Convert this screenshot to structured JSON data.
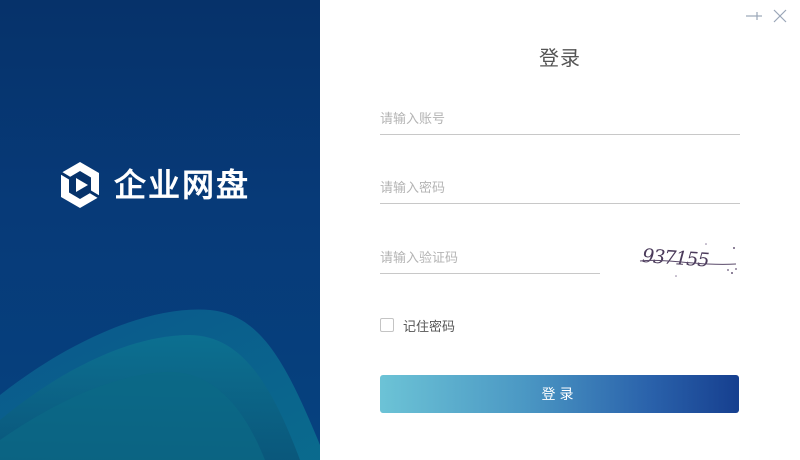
{
  "brand": {
    "name": "企业网盘",
    "logo_icon": "hexagon-play-logo"
  },
  "window_controls": {
    "pin_icon": "pin-icon",
    "close_icon": "close-icon"
  },
  "form": {
    "title": "登录",
    "account_placeholder": "请输入账号",
    "password_placeholder": "请输入密码",
    "captcha_placeholder": "请输入验证码",
    "captcha_text": "937155",
    "remember_label": "记住密码",
    "remember_checked": false,
    "login_label": "登录"
  },
  "colors": {
    "panel": "#06326a",
    "button_start": "#6cc3d6",
    "button_end": "#163f8f"
  }
}
